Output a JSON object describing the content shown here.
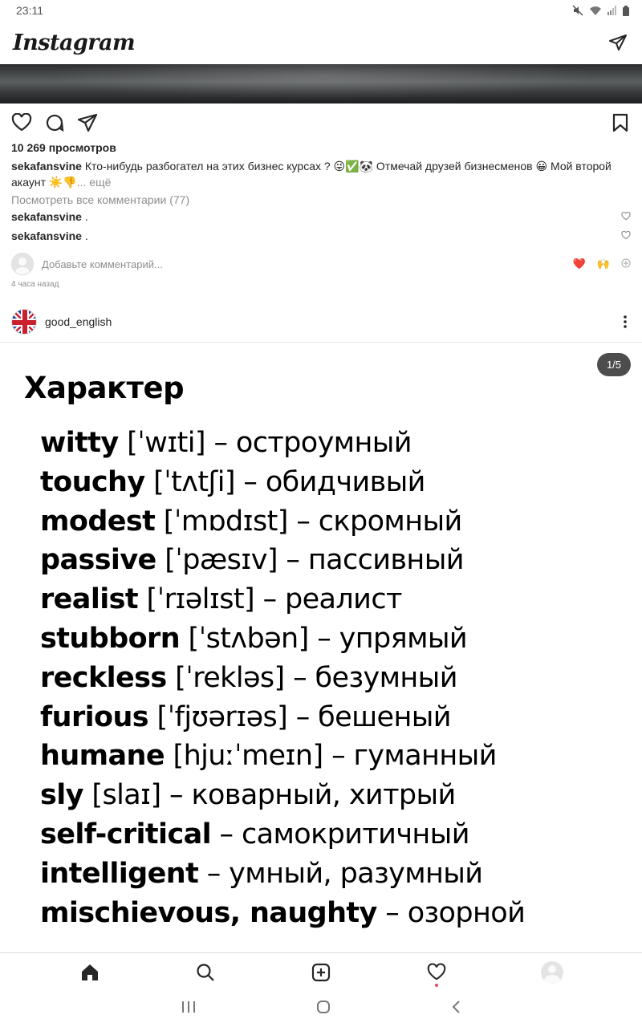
{
  "status_bar": {
    "time": "23:11"
  },
  "header": {
    "logo": "Instagram"
  },
  "post1": {
    "views": "10 269 просмотров",
    "caption_user": "sekafansvine",
    "caption_text": "Кто-нибудь разбогател на этих бизнес курсах ? 😜✅🐼 Отмечай друзей бизнесменов 😀 Мой второй акаунт ☀️👎",
    "caption_more": "... ещё",
    "view_comments": "Посмотреть все комментарии (77)",
    "comments": [
      {
        "user": "sekafansvine",
        "text": " ."
      },
      {
        "user": "sekafansvine",
        "text": " ."
      }
    ],
    "add_comment_placeholder": "Добавьте комментарий...",
    "quick_emojis": [
      "❤️",
      "🙌"
    ],
    "timestamp": "4 часа назад"
  },
  "post2": {
    "username": "good_english",
    "page_counter": "1/5",
    "image": {
      "title": "Характер",
      "lines": [
        {
          "word": "witty",
          "rest": " [ˈwɪti] – остроумный"
        },
        {
          "word": "touchy",
          "rest": " [ˈtʌtʃi] – обидчивый"
        },
        {
          "word": "modest",
          "rest": " [ˈmɒdɪst] – скромный"
        },
        {
          "word": "passive",
          "rest": " [ˈpæsɪv] – пассивный"
        },
        {
          "word": "realist",
          "rest": " [ˈrɪəlɪst] – реалист"
        },
        {
          "word": "stubborn",
          "rest": " [ˈstʌbən] – упрямый"
        },
        {
          "word": "reckless",
          "rest": " [ˈrekləs] – безумный"
        },
        {
          "word": "furious",
          "rest": " [ˈfjʊərɪəs] – бешеный"
        },
        {
          "word": "humane",
          "rest": " [hjuːˈmeɪn] – гуманный"
        },
        {
          "word": "sly",
          "rest": " [slaɪ] – коварный, хитрый"
        },
        {
          "word": "self-critical",
          "rest": " – самокритичный"
        },
        {
          "word": "intelligent",
          "rest": " – умный, разумный"
        },
        {
          "word": "mischievous, naughty",
          "rest": " – озорной"
        }
      ]
    }
  },
  "icons": {
    "status": [
      "mute-icon",
      "wifi-icon",
      "signal-icon",
      "battery-icon"
    ],
    "header": [
      "direct-message-icon"
    ],
    "actions": [
      "heart-icon",
      "comment-icon",
      "share-icon",
      "bookmark-icon"
    ],
    "bottom_nav": [
      "home-icon",
      "search-icon",
      "new-post-icon",
      "activity-icon",
      "profile-icon"
    ],
    "system_nav": [
      "recents-icon",
      "home-circle-icon",
      "back-icon"
    ]
  },
  "colors": {
    "notification_dot": "#ed4956",
    "heart_emoji": "#e0245e",
    "muted_text": "#8e8e8e"
  }
}
